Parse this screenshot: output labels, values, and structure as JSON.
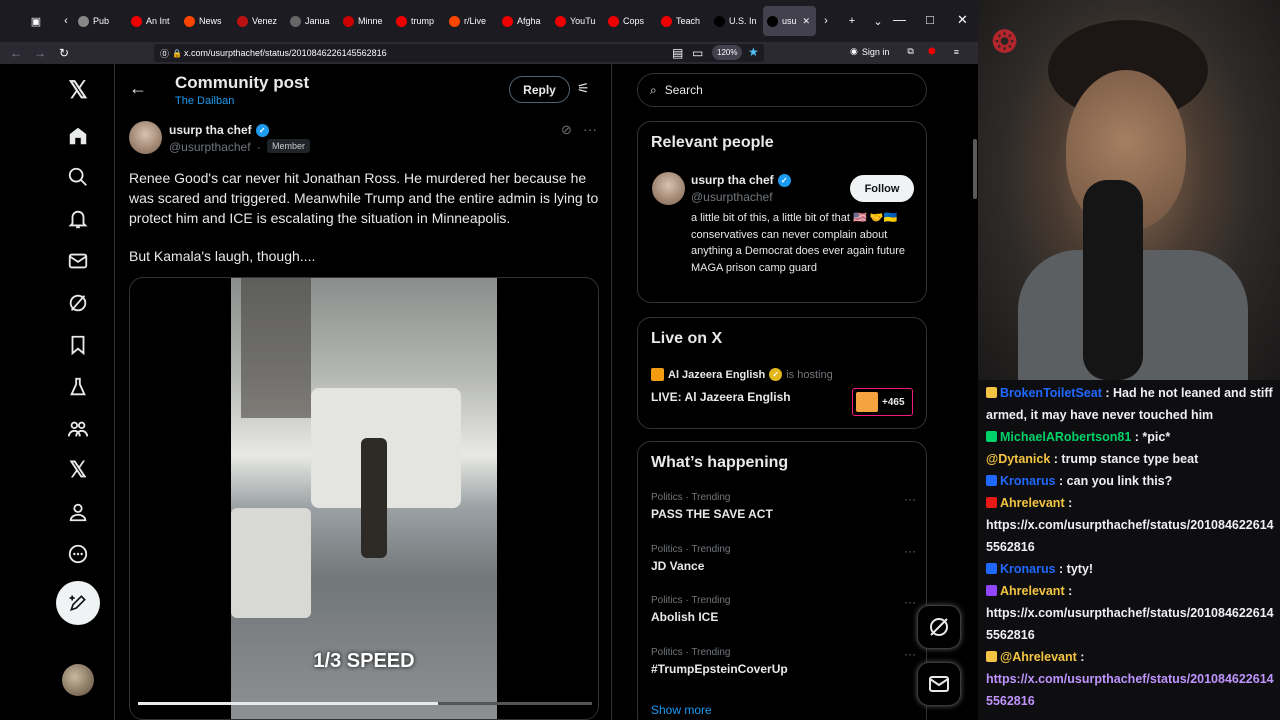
{
  "browser": {
    "tabs": [
      {
        "label": "Pub",
        "fav_color": "#888"
      },
      {
        "label": "An Int",
        "fav_color": "#e00"
      },
      {
        "label": "News",
        "fav_color": "#ff4500"
      },
      {
        "label": "Venez",
        "fav_color": "#b11"
      },
      {
        "label": "Janua",
        "fav_color": "#666"
      },
      {
        "label": "Minne",
        "fav_color": "#c00"
      },
      {
        "label": "trump",
        "fav_color": "#e00"
      },
      {
        "label": "r/Live",
        "fav_color": "#ff4500"
      },
      {
        "label": "Afgha",
        "fav_color": "#e00"
      },
      {
        "label": "YouTu",
        "fav_color": "#e00"
      },
      {
        "label": "Cops",
        "fav_color": "#e00"
      },
      {
        "label": "Teach",
        "fav_color": "#e00"
      },
      {
        "label": "U.S. In",
        "fav_color": "#000"
      },
      {
        "label": "usu",
        "fav_color": "#000"
      }
    ],
    "url": "x.com/usurpthachef/status/2010846226145562816",
    "zoom": "120%",
    "sign_in": "Sign in"
  },
  "x": {
    "header": {
      "title": "Community post",
      "subtitle": "The Dailban",
      "reply": "Reply"
    },
    "post": {
      "name": "usurp tha chef",
      "handle": "@usurpthachef",
      "sep": "·",
      "member": "Member",
      "text": "Renee Good's car never hit Jonathan Ross. He murdered her because he was scared and triggered. Meanwhile Trump and the entire admin is lying to protect him and ICE is escalating the situation in Minneapolis.",
      "text2": "But Kamala's laugh, though....",
      "video_caption": "1/3 SPEED",
      "video_progress": 0.66
    },
    "search_placeholder": "Search",
    "relevant": {
      "title": "Relevant people",
      "name": "usurp tha chef",
      "handle": "@usurpthachef",
      "follow": "Follow",
      "bio": "a little bit of this, a little bit of that 🇺🇸 🤝🇺🇦 conservatives can never complain about anything a Democrat does ever again future MAGA prison camp guard"
    },
    "live": {
      "title": "Live on X",
      "host": "Al Jazeera English",
      "hosting": "is hosting",
      "stream_title": "LIVE: Al Jazeera English",
      "viewers": "+465"
    },
    "happening": {
      "title": "What’s happening",
      "trends": [
        {
          "cat": "Politics · Trending",
          "name": "PASS THE SAVE ACT"
        },
        {
          "cat": "Politics · Trending",
          "name": "JD Vance"
        },
        {
          "cat": "Politics · Trending",
          "name": "Abolish ICE"
        },
        {
          "cat": "Politics · Trending",
          "name": "#TrumpEpsteinCoverUp"
        }
      ],
      "show_more": "Show more"
    }
  },
  "chat": [
    {
      "user": "BrokenToiletSeat",
      "color": "#1f69ff",
      "text": " : Had he not leaned and stiff armed, it may have never touched him",
      "badge": "#f4c542"
    },
    {
      "user": "MichaelARobertson81",
      "color": "#00d26a",
      "text": " : *pic*",
      "badge": "#00d26a"
    },
    {
      "user": "@Dytanick",
      "color": "#f4c542",
      "text": " : trump stance type beat",
      "badge": ""
    },
    {
      "user": "Kronarus",
      "color": "#1f69ff",
      "text": " : can you link this?",
      "badge": "#1f69ff"
    },
    {
      "user": "Ahrelevant",
      "color": "#f4c542",
      "text": " :",
      "badge": "#e91916"
    },
    {
      "user": "",
      "color": "#efeff1",
      "text": "https://x.com/usurpthachef/status/2010846226145562816",
      "badge": ""
    },
    {
      "user": "Kronarus",
      "color": "#1f69ff",
      "text": " : tyty!",
      "badge": "#1f69ff"
    },
    {
      "user": "Ahrelevant",
      "color": "#f4c542",
      "text": " :",
      "badge": "#9147ff"
    },
    {
      "user": "",
      "color": "#efeff1",
      "text": "https://x.com/usurpthachef/status/2010846226145562816",
      "badge": ""
    },
    {
      "user": "@Ahrelevant",
      "color": "#f4c542",
      "text": " :",
      "badge": "#f4c542"
    },
    {
      "user": "",
      "color": "#bf94ff",
      "text": "https://x.com/usurpthachef/status/2010846226145562816",
      "badge": ""
    }
  ]
}
